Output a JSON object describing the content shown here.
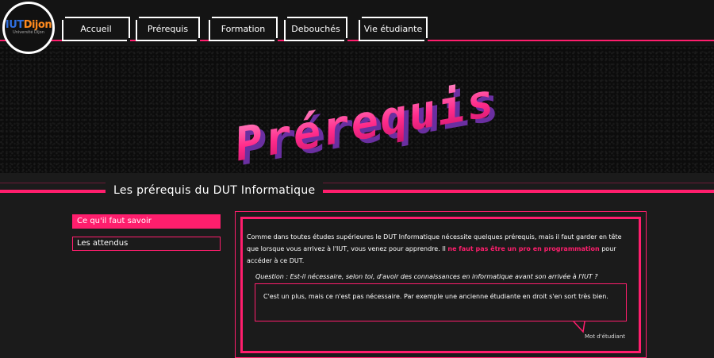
{
  "logo": {
    "main": "IUT",
    "accent": "Dijon",
    "sub": "Université Dijon"
  },
  "nav": [
    {
      "label": "Accueil"
    },
    {
      "label": "Prérequis"
    },
    {
      "label": "Formation"
    },
    {
      "label": "Debouchés"
    },
    {
      "label": "Vie étudiante"
    }
  ],
  "banner": {
    "title": "Prérequis"
  },
  "section": {
    "title": "Les prérequis du DUT Informatique"
  },
  "sidebar": [
    {
      "label": "Ce qu'il faut savoir",
      "active": true
    },
    {
      "label": "Les attendus",
      "active": false
    }
  ],
  "content": {
    "para_before": "Comme dans toutes études supérieures le DUT Informatique nécessite quelques prérequis, mais il faut garder en tête que lorsque vous arrivez à l'IUT, vous venez pour apprendre. Il ",
    "para_highlight": "ne faut pas être un pro en programmation",
    "para_after": " pour accéder à ce DUT.",
    "question": "Question : Est-il nécessaire, selon toi, d'avoir des connaissances en informatique avant son arrivée à l'IUT ?",
    "answer": "C'est un plus, mais ce n'est pas nécessaire. Par exemple une ancienne étudiante en droit s'en sort très bien.",
    "signature": "Mot d'étudiant"
  },
  "colors": {
    "accent": "#ff1e6d",
    "background": "#1b1b1b",
    "title_light": "#ff4da0",
    "title_shadow": "#6a2fa0"
  }
}
